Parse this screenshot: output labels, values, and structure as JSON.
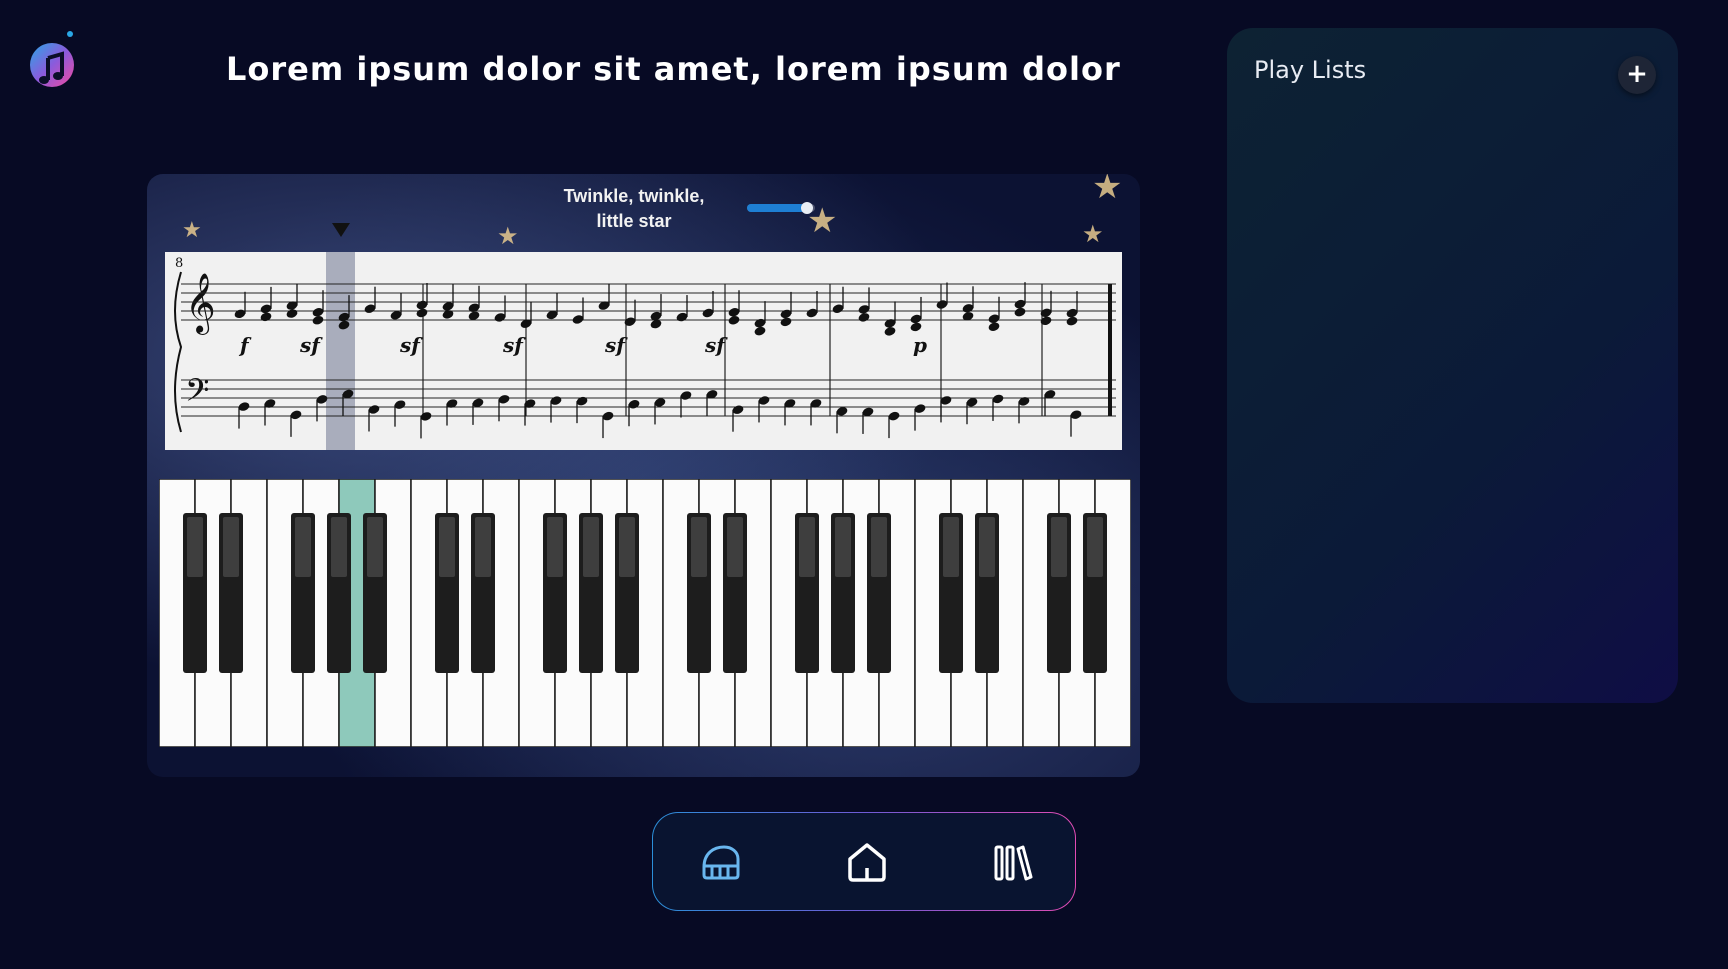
{
  "header": {
    "title": "Lorem ipsum dolor sit amet, lorem ipsum dolor"
  },
  "player": {
    "song_title": "Twinkle, twinkle, little star",
    "progress_percent": 85,
    "measure_number": "8",
    "dynamics": [
      "f",
      "sf",
      "sf",
      "sf",
      "sf",
      "sf",
      "p"
    ]
  },
  "playlists": {
    "title": "Play Lists",
    "add_label": "+"
  },
  "nav": {
    "items": [
      "piano-icon",
      "home-icon",
      "library-icon"
    ]
  },
  "colors": {
    "background": "#070a24",
    "accent": "#1e7fd4",
    "highlight_key": "#8ec9bb",
    "nav_gradient": [
      "#2b8fd8",
      "#e14bb3"
    ]
  }
}
